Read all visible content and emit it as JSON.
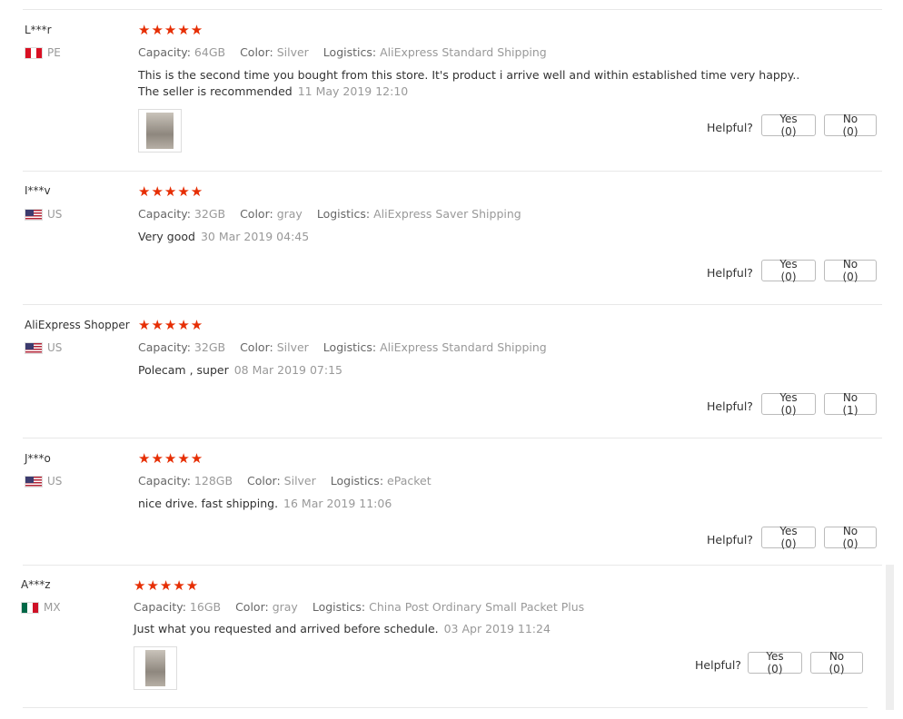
{
  "labels": {
    "capacity": "Capacity:",
    "color": "Color:",
    "logistics": "Logistics:",
    "helpful": "Helpful?"
  },
  "reviews": [
    {
      "user": "L***r",
      "country": "PE",
      "flag": "flag-pe-icon",
      "stars": "★★★★★",
      "rating": 5,
      "capacity": "64GB",
      "color": "Silver",
      "logistics": "AliExpress Standard Shipping",
      "text_line1": "This is the second time you bought from this store. It's product i arrive well and within established time very happy..",
      "text_line2": "The seller is recommended",
      "date": "11 May 2019 12:10",
      "yes": "Yes (0)",
      "no": "No (0)",
      "has_photo": true
    },
    {
      "user": "I***v",
      "country": "US",
      "flag": "flag-us-icon",
      "stars": "★★★★★",
      "rating": 5,
      "capacity": "32GB",
      "color": "gray",
      "logistics": "AliExpress Saver Shipping",
      "text_line1": "Very good",
      "date": "30 Mar 2019 04:45",
      "yes": "Yes (0)",
      "no": "No (0)",
      "has_photo": false
    },
    {
      "user": "AliExpress Shopper",
      "country": "US",
      "flag": "flag-us-icon",
      "stars": "★★★★★",
      "rating": 5,
      "capacity": "32GB",
      "color": "Silver",
      "logistics": "AliExpress Standard Shipping",
      "text_line1": "Polecam , super",
      "date": "08 Mar 2019 07:15",
      "yes": "Yes (0)",
      "no": "No (1)",
      "has_photo": false
    },
    {
      "user": "J***o",
      "country": "US",
      "flag": "flag-us-icon",
      "stars": "★★★★★",
      "rating": 5,
      "capacity": "128GB",
      "color": "Silver",
      "logistics": "ePacket",
      "text_line1": "nice drive. fast shipping.",
      "date": "16 Mar 2019 11:06",
      "yes": "Yes (0)",
      "no": "No (0)",
      "has_photo": false
    },
    {
      "user": "A***z",
      "country": "MX",
      "flag": "flag-mx-icon",
      "stars": "★★★★★",
      "rating": 5,
      "capacity": "16GB",
      "color": "gray",
      "logistics": "China Post Ordinary Small Packet Plus",
      "text_line1": "Just what you requested and arrived before schedule.",
      "date": "03 Apr 2019 11:24",
      "yes": "Yes (0)",
      "no": "No (0)",
      "has_photo": true
    }
  ]
}
